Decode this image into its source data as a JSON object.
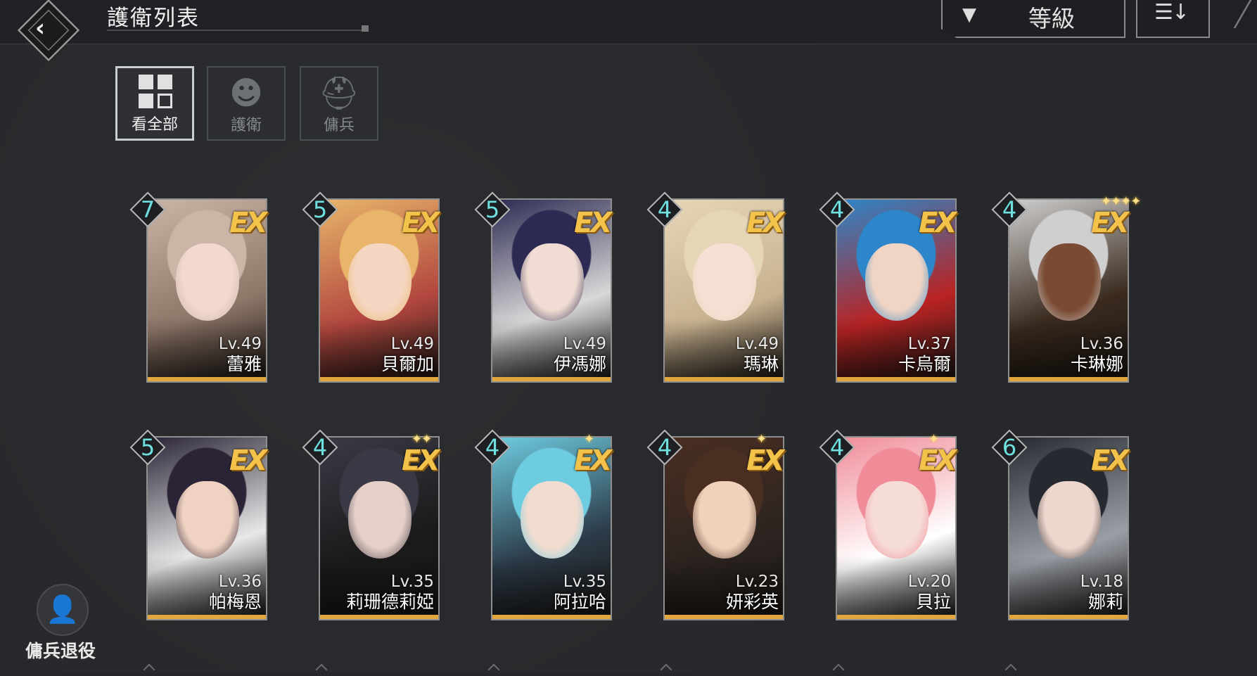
{
  "header": {
    "title": "護衛列表",
    "filter_label": "等級",
    "filter_icon": "funnel-icon",
    "sort_icon": "sort-descending-icon",
    "back_icon": "back-arrow-icon"
  },
  "tabs": [
    {
      "label": "看全部",
      "icon": "grid-icon",
      "active": true
    },
    {
      "label": "護衛",
      "icon": "head-profile-icon",
      "active": false
    },
    {
      "label": "傭兵",
      "icon": "helmet-icon",
      "active": false
    }
  ],
  "cards": [
    {
      "rank": "7",
      "level": "Lv.49",
      "name": "蕾雅",
      "grade": "EX",
      "stars": "",
      "palette": [
        "#cbb5a6",
        "#f2d8ce",
        "#8d7568"
      ]
    },
    {
      "rank": "5",
      "level": "Lv.49",
      "name": "貝爾加",
      "grade": "EX",
      "stars": "",
      "palette": [
        "#e8b56a",
        "#f5d6c2",
        "#b2473f"
      ]
    },
    {
      "rank": "5",
      "level": "Lv.49",
      "name": "伊馮娜",
      "grade": "EX",
      "stars": "",
      "palette": [
        "#2c2a52",
        "#f0dcd2",
        "#d8d8d8"
      ]
    },
    {
      "rank": "4",
      "level": "Lv.49",
      "name": "瑪琳",
      "grade": "EX",
      "stars": "",
      "palette": [
        "#e6d6b8",
        "#f6e0d6",
        "#c8b290"
      ]
    },
    {
      "rank": "4",
      "level": "Lv.37",
      "name": "卡烏爾",
      "grade": "EX",
      "stars": "",
      "palette": [
        "#2c86c9",
        "#f0d4c4",
        "#b92323"
      ]
    },
    {
      "rank": "4",
      "level": "Lv.36",
      "name": "卡琳娜",
      "grade": "EX",
      "stars": "✦✦✦✦",
      "palette": [
        "#cfcfcf",
        "#7a4a32",
        "#3a2a1e"
      ]
    },
    {
      "rank": "5",
      "level": "Lv.36",
      "name": "帕梅恩",
      "grade": "EX",
      "stars": "",
      "palette": [
        "#2a2436",
        "#f0d2c2",
        "#e8e8e8"
      ]
    },
    {
      "rank": "4",
      "level": "Lv.35",
      "name": "莉珊德莉婭",
      "grade": "EX",
      "stars": "✦✦",
      "palette": [
        "#3a3a46",
        "#e6cfc6",
        "#1a1a1a"
      ]
    },
    {
      "rank": "4",
      "level": "Lv.35",
      "name": "阿拉哈",
      "grade": "EX",
      "stars": "✦",
      "palette": [
        "#6ecce0",
        "#f2dcd0",
        "#2c3a48"
      ]
    },
    {
      "rank": "4",
      "level": "Lv.23",
      "name": "妍彩英",
      "grade": "EX",
      "stars": "✦",
      "palette": [
        "#4a2e22",
        "#f0d2bc",
        "#2c2420"
      ]
    },
    {
      "rank": "4",
      "level": "Lv.20",
      "name": "貝拉",
      "grade": "EX",
      "stars": "✦",
      "palette": [
        "#f08c98",
        "#f6dcd6",
        "#ffffff"
      ]
    },
    {
      "rank": "6",
      "level": "Lv.18",
      "name": "娜莉",
      "grade": "EX",
      "stars": "",
      "palette": [
        "#262a30",
        "#eed6cc",
        "#9a9ea6"
      ]
    }
  ],
  "discharge": {
    "label": "傭兵退役",
    "icon": "remove-user-icon"
  }
}
